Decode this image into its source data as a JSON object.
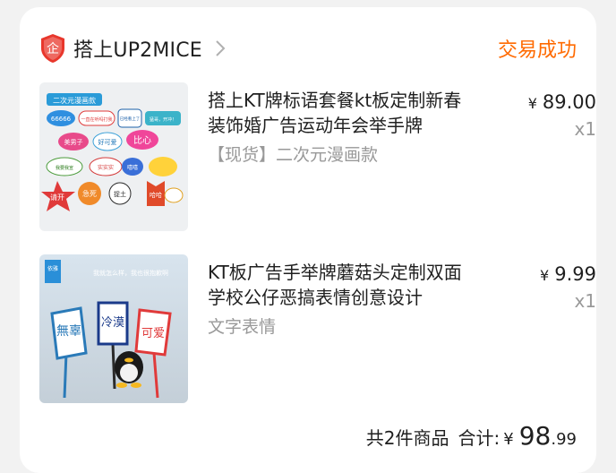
{
  "shop": {
    "name": "搭上UP2MICE",
    "badge_icon": "enterprise-shield-icon",
    "badge_text": "企",
    "badge_color": "#e8372c",
    "status": "交易成功",
    "status_color": "#ff6a00"
  },
  "items": [
    {
      "title": "搭上KT牌标语套餐kt板定制新春装饰婚广告运动年会举手牌",
      "sku": "【现货】二次元漫画款",
      "price_symbol": "¥",
      "price": "89.00",
      "qty": "x1",
      "thumb": {
        "header": "二次元漫画款",
        "bubbles": [
          "66666",
          "一直在听吗打我",
          "已经看上了",
          "猛哥，开冲！",
          "美男子",
          "好可爱",
          "比心",
          "我要我宣",
          "实实实",
          "嘻嘻",
          "请开",
          "急死",
          "捉土",
          "哈哈"
        ]
      }
    },
    {
      "title": "KT板广告手举牌蘑菇头定制双面学校公仔恶搞表情创意设计",
      "sku": "文字表情",
      "price_symbol": "¥",
      "price": "9.99",
      "qty": "x1",
      "thumb": {
        "corner_tag": "依雅",
        "top_text": "我就怎么样，我也很抱歉啊",
        "signs": [
          "無辜",
          "冷漠",
          "可爱"
        ]
      }
    }
  ],
  "summary": {
    "count_text": "共2件商品",
    "total_label": "合计:",
    "currency": "¥",
    "total_int": "98",
    "total_dec": ".99"
  }
}
